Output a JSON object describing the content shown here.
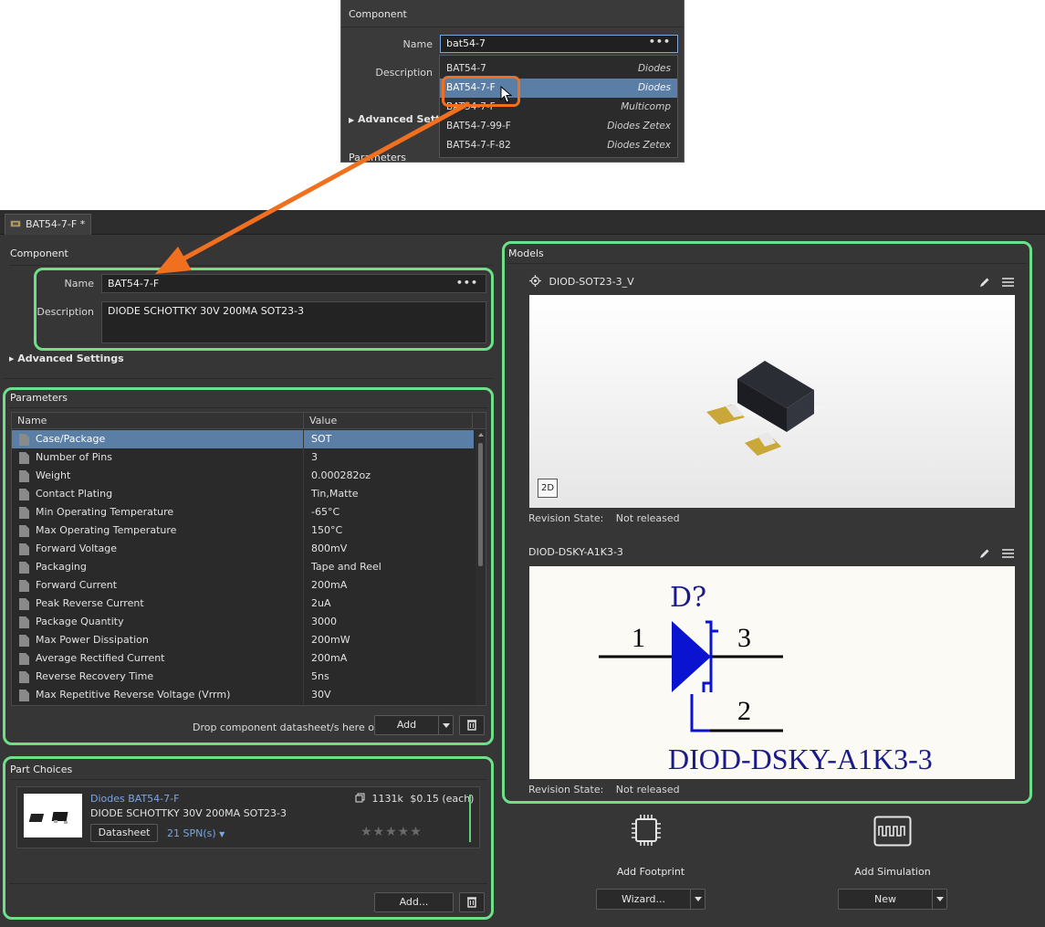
{
  "popup": {
    "section_title": "Component",
    "name_label": "Name",
    "name_value": "bat54-7",
    "description_label": "Description",
    "advanced_label": "Advanced Setting",
    "parameters_label": "Parameters",
    "suggestions": [
      {
        "part": "BAT54-7",
        "manufacturer": "Diodes",
        "selected": false
      },
      {
        "part": "BAT54-7-F",
        "manufacturer": "Diodes",
        "selected": true
      },
      {
        "part": "BAT54-7-F",
        "manufacturer": "Multicomp",
        "selected": false
      },
      {
        "part": "BAT54-7-99-F",
        "manufacturer": "Diodes Zetex",
        "selected": false
      },
      {
        "part": "BAT54-7-F-82",
        "manufacturer": "Diodes Zetex",
        "selected": false
      }
    ]
  },
  "tab": {
    "label": "BAT54-7-F *"
  },
  "component": {
    "title": "Component",
    "name_label": "Name",
    "name_value": "BAT54-7-F",
    "description_label": "Description",
    "description_value": "DIODE SCHOTTKY 30V 200MA SOT23-3",
    "advanced_label": "Advanced Settings"
  },
  "parameters": {
    "title": "Parameters",
    "col_name": "Name",
    "col_value": "Value",
    "rows": [
      {
        "name": "Case/Package",
        "value": "SOT"
      },
      {
        "name": "Number of Pins",
        "value": "3"
      },
      {
        "name": "Weight",
        "value": "0.000282oz"
      },
      {
        "name": "Contact Plating",
        "value": "Tin,Matte"
      },
      {
        "name": "Min Operating Temperature",
        "value": "-65°C"
      },
      {
        "name": "Max Operating Temperature",
        "value": "150°C"
      },
      {
        "name": "Forward Voltage",
        "value": "800mV"
      },
      {
        "name": "Packaging",
        "value": "Tape and Reel"
      },
      {
        "name": "Forward Current",
        "value": "200mA"
      },
      {
        "name": "Peak Reverse Current",
        "value": "2uA"
      },
      {
        "name": "Package Quantity",
        "value": "3000"
      },
      {
        "name": "Max Power Dissipation",
        "value": "200mW"
      },
      {
        "name": "Average Rectified Current",
        "value": "200mA"
      },
      {
        "name": "Reverse Recovery Time",
        "value": "5ns"
      },
      {
        "name": "Max Repetitive Reverse Voltage (Vrrm)",
        "value": "30V"
      }
    ],
    "drop_hint": "Drop component datasheet/s here or",
    "add_label": "Add"
  },
  "part_choices": {
    "title": "Part Choices",
    "manufacturer_part": "Diodes BAT54-7-F",
    "description": "DIODE SCHOTTKY 30V 200MA SOT23-3",
    "stock": "1131k",
    "price": "$0.15 (each)",
    "datasheet_label": "Datasheet",
    "spn_label": "21 SPN(s)",
    "rating_stars": "★★★★★",
    "add_label": "Add..."
  },
  "models": {
    "title": "Models",
    "footprint": {
      "name": "DIOD-SOT23-3_V",
      "toggle_label": "2D",
      "revision_label": "Revision State:",
      "revision_value": "Not released"
    },
    "symbol": {
      "name": "DIOD-DSKY-A1K3-3",
      "designator": "D?",
      "pin1": "1",
      "pin2": "2",
      "pin3": "3",
      "comment": "DIOD-DSKY-A1K3-3",
      "revision_label": "Revision State:",
      "revision_value": "Not released"
    }
  },
  "add_footprint": {
    "label": "Add Footprint",
    "button": "Wizard..."
  },
  "add_simulation": {
    "label": "Add Simulation",
    "button": "New"
  },
  "colors": {
    "highlight_green": "#6fe08a",
    "callout_orange": "#f07020",
    "selection_blue": "#5b7ea6",
    "symbol_blue": "#0a14d0",
    "symbol_navy": "#1a1a8a"
  }
}
